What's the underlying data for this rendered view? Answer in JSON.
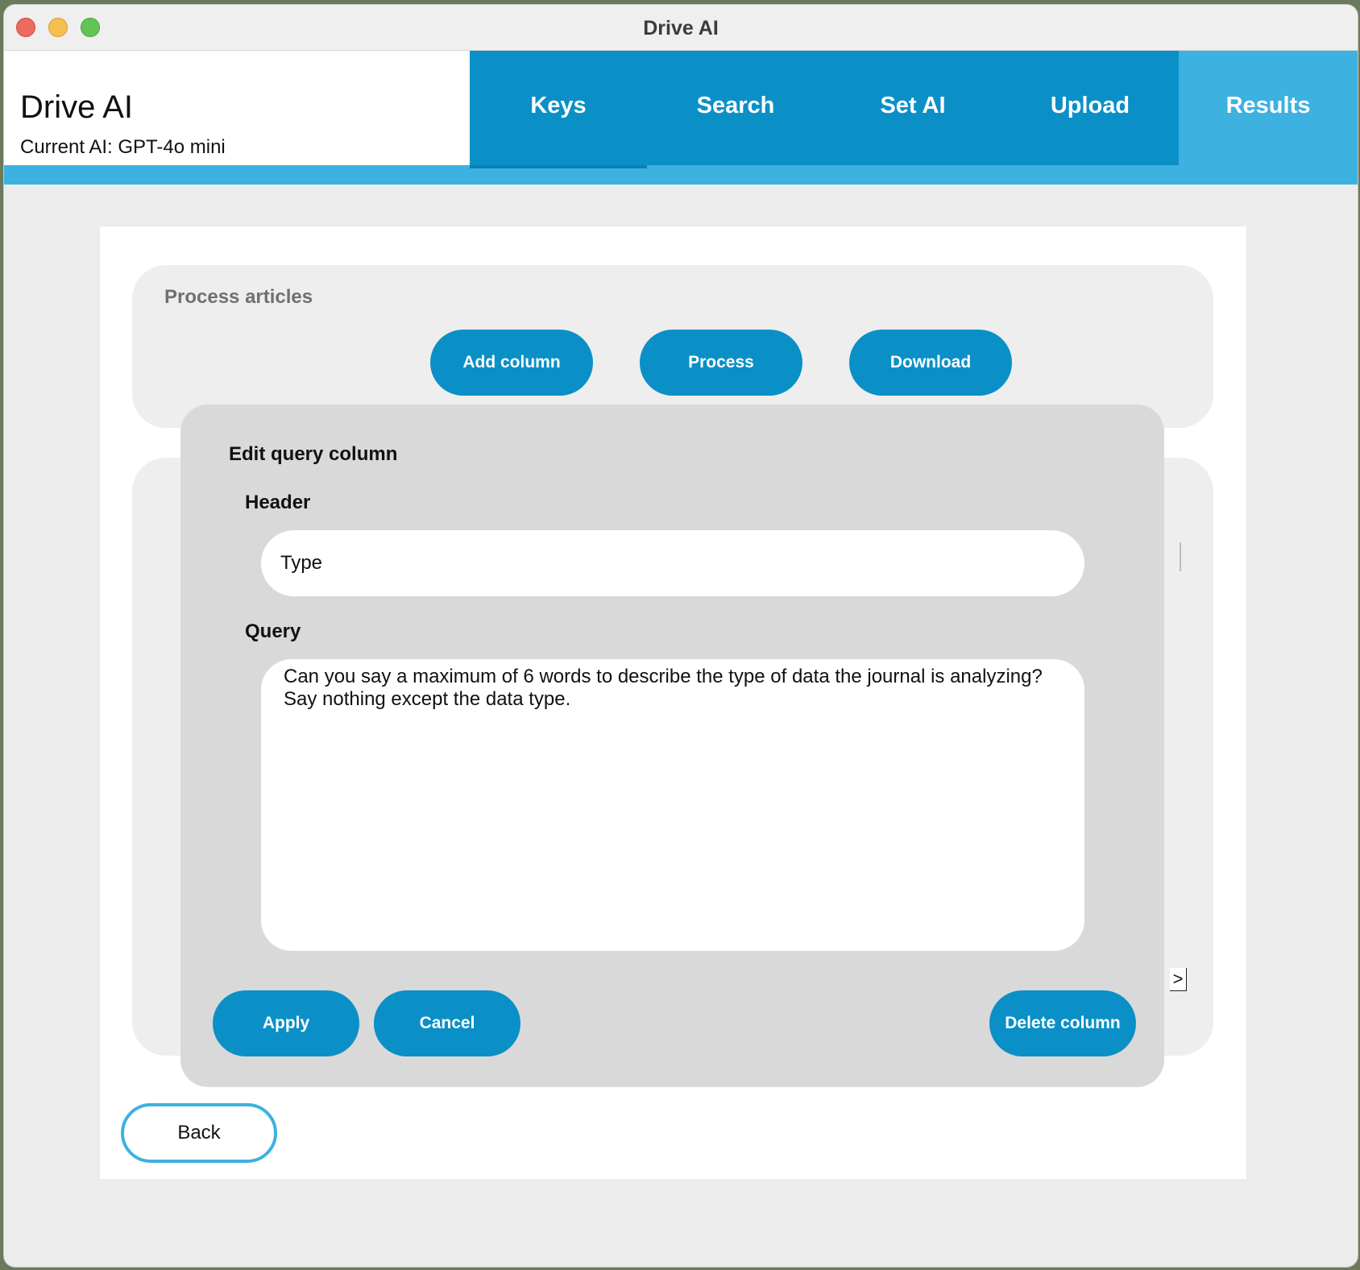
{
  "window": {
    "title": "Drive AI"
  },
  "brand": {
    "title": "Drive AI",
    "current_ai": "Current AI: GPT-4o mini"
  },
  "nav": {
    "tabs": [
      {
        "label": "Keys"
      },
      {
        "label": "Search"
      },
      {
        "label": "Set AI"
      },
      {
        "label": "Upload"
      },
      {
        "label": "Results"
      }
    ],
    "active": "Results"
  },
  "process_panel": {
    "label": "Process articles",
    "add_column": "Add column",
    "process": "Process",
    "download": "Download"
  },
  "next_arrow": ">",
  "back": "Back",
  "modal": {
    "title": "Edit query column",
    "header_label": "Header",
    "header_value": "Type",
    "query_label": "Query",
    "query_line1": "Can you say a maximum of 6 words to describe the type of data the journal is analyzing?",
    "query_line2": "Say nothing except the data type.",
    "apply": "Apply",
    "cancel": "Cancel",
    "delete": "Delete column"
  },
  "colors": {
    "primary": "#0a90c7",
    "accent": "#3db1e0",
    "panel": "#eeeeee",
    "modal": "#d9d9d9"
  }
}
